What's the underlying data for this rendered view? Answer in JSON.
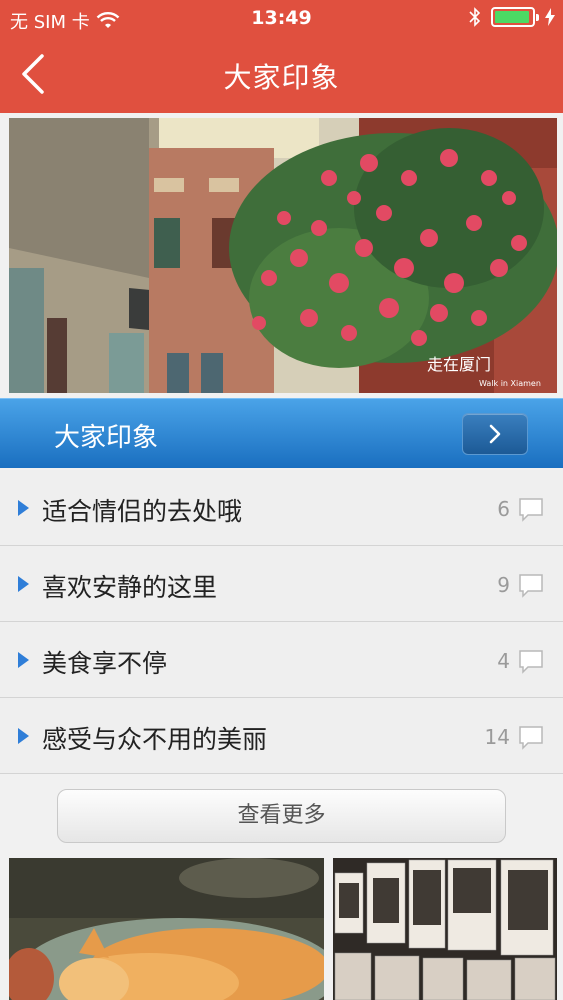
{
  "status_bar": {
    "carrier": "无 SIM 卡",
    "time": "13:49",
    "battery_color": "#4cd964"
  },
  "nav": {
    "title": "大家印象",
    "back_icon": "chevron-left-icon"
  },
  "hero": {
    "caption": "走在厦门",
    "caption_sub": "Walk in Xiamen"
  },
  "section": {
    "title": "大家印象",
    "more_icon": "chevron-right-icon"
  },
  "topics": [
    {
      "label": "适合情侣的去处哦",
      "count": "6"
    },
    {
      "label": "喜欢安静的这里",
      "count": "9"
    },
    {
      "label": "美食享不停",
      "count": "4"
    },
    {
      "label": "感受与众不用的美丽",
      "count": "14"
    }
  ],
  "more_button": "查看更多",
  "colors": {
    "nav_bg": "#e0503f",
    "section_bg": "#2a84d8",
    "accent": "#2f7ed8"
  }
}
